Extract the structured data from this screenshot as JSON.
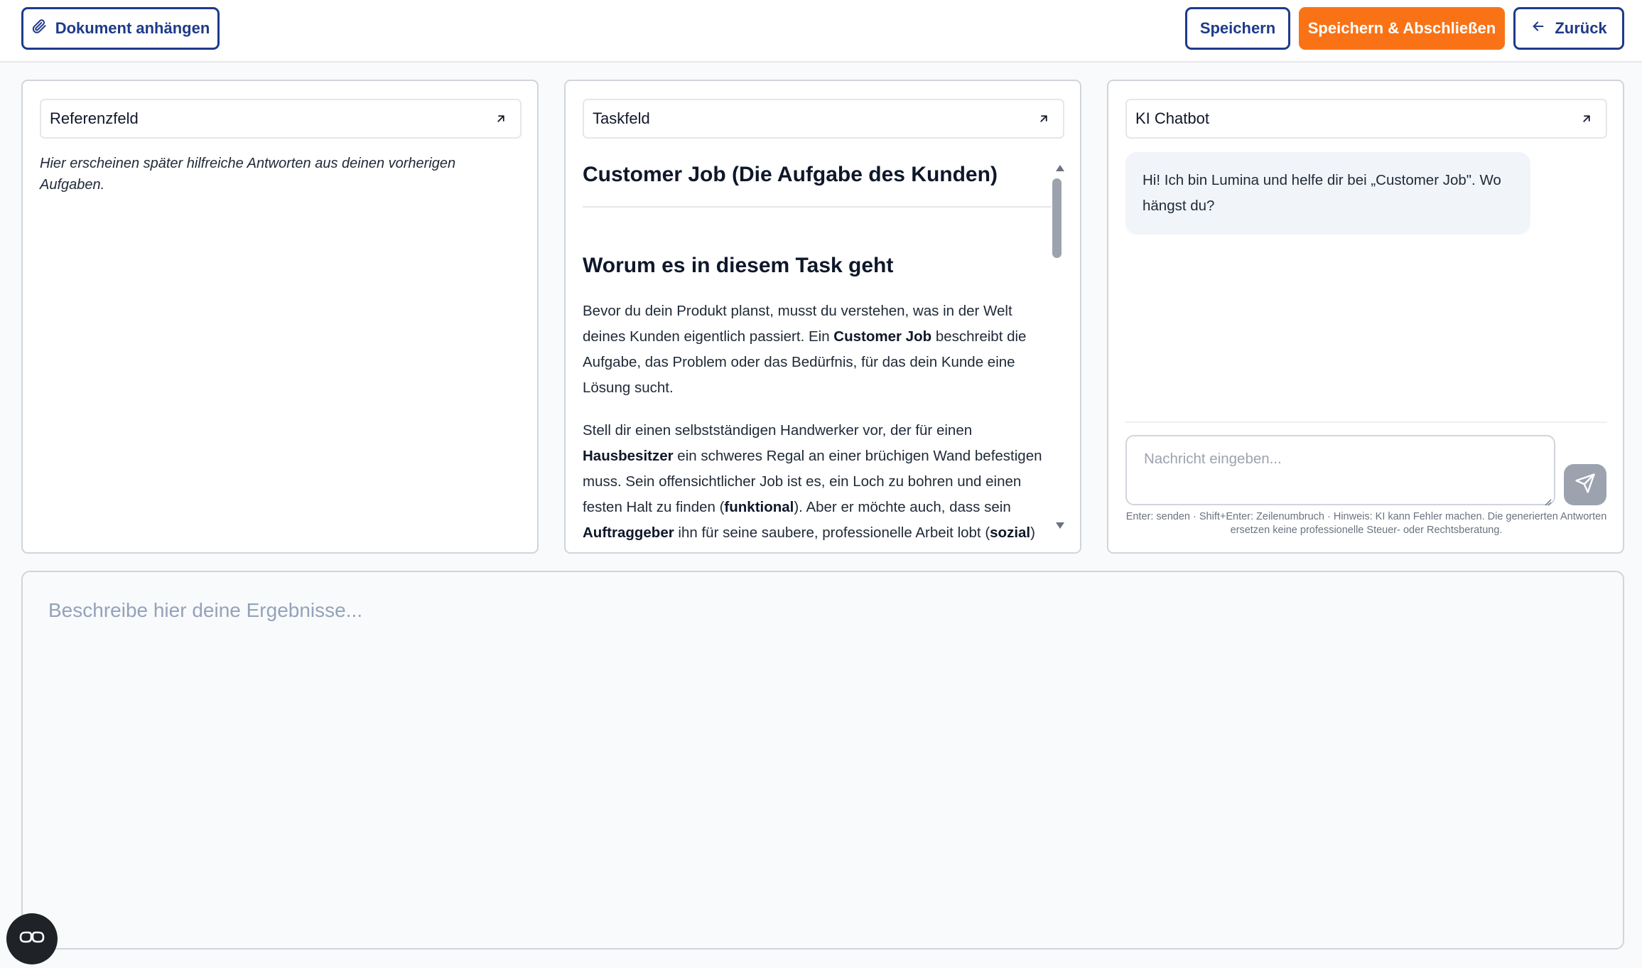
{
  "toolbar": {
    "attach_label": "Dokument anhängen",
    "save_label": "Speichern",
    "finish_label": "Speichern & Abschließen",
    "back_label": "Zurück",
    "accent_color": "#f97316",
    "primary_color": "#1e3a8a"
  },
  "reference_panel": {
    "title": "Referenzfeld",
    "placeholder_text": "Hier erscheinen später hilfreiche Antworten aus deinen vorherigen Aufgaben."
  },
  "task_panel": {
    "title": "Taskfeld",
    "heading": "Customer Job (Die Aufgabe des Kunden)",
    "subheading": "Worum es in diesem Task geht",
    "p1": {
      "t1": "Bevor du dein Produkt planst, musst du verstehen, was in der Welt deines Kunden eigentlich passiert. Ein ",
      "b1": "Customer Job",
      "t2": " beschreibt die Aufgabe, das Problem oder das Bedürfnis, für das dein Kunde eine Lösung sucht."
    },
    "p2": {
      "t1": "Stell dir einen selbstständigen Handwerker vor, der für einen ",
      "b1": "Hausbesitzer",
      "t2": " ein schweres Regal an einer brüchigen Wand befestigen muss. Sein offensichtlicher Job ist es, ein Loch zu bohren und einen festen Halt zu finden (",
      "b2": "funktional",
      "t3": "). Aber er möchte auch, dass sein ",
      "b3": "Auftraggeber",
      "t4": " ihn für seine saubere, professionelle Arbeit lobt (",
      "b4": "sozial",
      "t5": ")"
    }
  },
  "chat_panel": {
    "title": "KI Chatbot",
    "greeting": "Hi! Ich bin Lumina und helfe dir bei „Customer Job\". Wo hängst du?",
    "input_placeholder": "Nachricht eingeben...",
    "hint": "Enter: senden · Shift+Enter: Zeilenumbruch · Hinweis: KI kann Fehler machen. Die generierten Antworten ersetzen keine professionelle Steuer- oder Rechtsberatung."
  },
  "results": {
    "placeholder": "Beschreibe hier deine Ergebnisse..."
  },
  "icons": {
    "attach": "paperclip-icon",
    "back": "arrow-left-icon",
    "expand": "arrow-up-right-icon",
    "send": "send-icon",
    "fab": "glasses-icon"
  }
}
